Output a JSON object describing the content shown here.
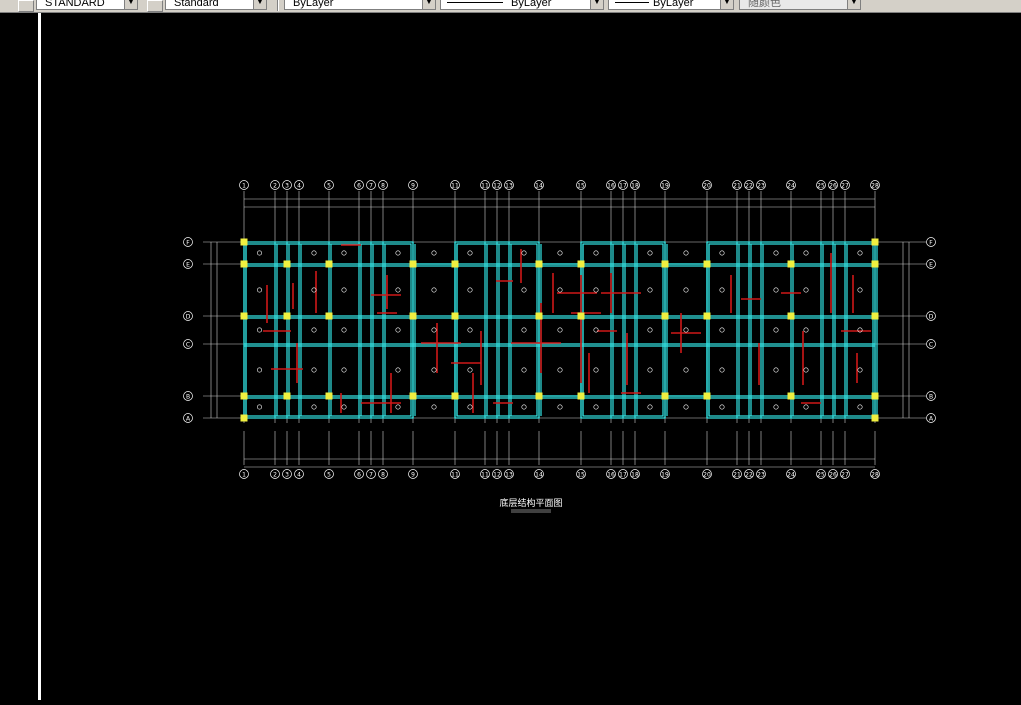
{
  "toolbar": {
    "text_style": "STANDARD",
    "dim_style": "Standard",
    "layer_color": "ByLayer",
    "linetype": "ByLayer",
    "lineweight": "ByLayer",
    "plot_style": "随颜色"
  },
  "drawing": {
    "title": "底层结构平面图",
    "col_axes": [
      "1",
      "2",
      "3",
      "4",
      "5",
      "6",
      "7",
      "8",
      "9",
      "11",
      "11",
      "12",
      "13",
      "14",
      "15",
      "16",
      "17",
      "18",
      "19",
      "20",
      "21",
      "22",
      "23",
      "24",
      "25",
      "26",
      "27",
      "28"
    ],
    "row_axes_left": [
      "F",
      "E",
      "D",
      "C",
      "B",
      "A"
    ],
    "row_axes_right": [
      "F",
      "E",
      "D",
      "C",
      "B",
      "A"
    ]
  },
  "colors": {
    "background": "#000000",
    "wall": "#33e6e6",
    "beam": "#d01818",
    "column": "#f0f040",
    "text": "#ffffff"
  }
}
